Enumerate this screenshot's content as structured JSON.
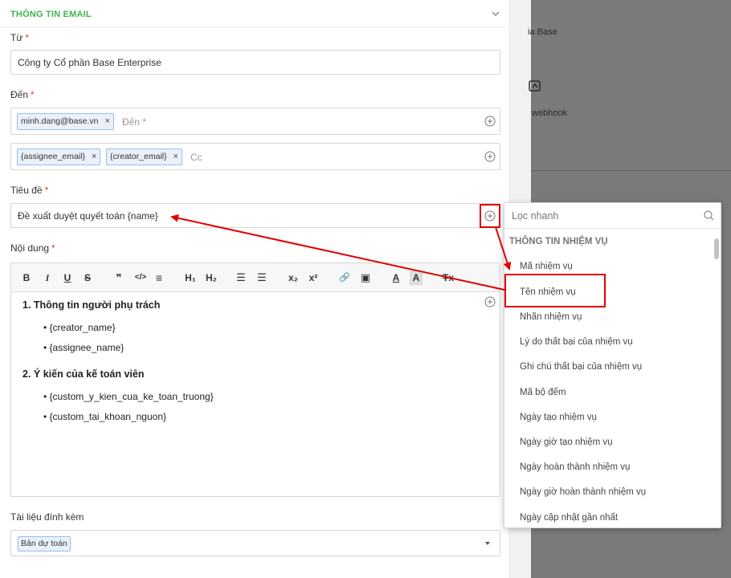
{
  "background": {
    "text_1": "ia Base",
    "text_2": "webhook"
  },
  "section": {
    "title": "THÔNG TIN EMAIL",
    "chevron_icon": "chevron-down-icon"
  },
  "from": {
    "label": "Từ",
    "required": "*",
    "value": "Công ty Cổ phần Base Enterprise"
  },
  "to": {
    "label": "Đến",
    "required": "*",
    "tags": [
      "minh.dang@base.vn"
    ],
    "placeholder": "Đến *"
  },
  "cc": {
    "tags": [
      "{assignee_email}",
      "{creator_email}"
    ],
    "placeholder": "Cc"
  },
  "tag_remove": "×",
  "subject": {
    "label": "Tiêu đề",
    "required": "*",
    "value": "Đề xuất duyệt quyết toán {name}"
  },
  "content": {
    "label": "Nội dung",
    "required": "*",
    "toolbar": {
      "bold": "B",
      "italic": "I",
      "underline": "U",
      "strike": "S",
      "quote": "❞",
      "code": "</>",
      "align": "≡",
      "h1": "H₁",
      "h2": "H₂",
      "ordered_list": "☰",
      "bullet_list": "☰",
      "subscript": "x₂",
      "superscript": "x²",
      "link": "🔗",
      "image": "▣",
      "text_color": "A",
      "bg_color": "A",
      "clear": "Tx"
    },
    "heading_1": "1. Thông tin người phụ trách",
    "items_1": [
      "{creator_name}",
      "{assignee_name}"
    ],
    "heading_2": "2. Ý kiến của kế toán viên",
    "items_2": [
      "{custom_y_kien_cua_ke_toan_truong}",
      "{custom_tai_khoan_nguon}"
    ],
    "bullet": "•"
  },
  "attachments": {
    "label": "Tài liệu đính kèm",
    "value": "Bản dự toán"
  },
  "dropdown": {
    "search_placeholder": "Lọc nhanh",
    "group": "THÔNG TIN NHIỆM VỤ",
    "items": [
      "Mã nhiệm vụ",
      "Tên nhiệm vụ",
      "Nhãn nhiệm vụ",
      "Lý do thất bại của nhiệm vụ",
      "Ghi chú thất bại của nhiệm vụ",
      "Mã bộ đếm",
      "Ngày tạo nhiệm vụ",
      "Ngày giờ tạo nhiệm vụ",
      "Ngày hoàn thành nhiệm vụ",
      "Ngày giờ hoàn thành nhiệm vụ",
      "Ngày cập nhật gần nhất"
    ],
    "highlighted_item": "Tên nhiệm vụ"
  },
  "colors": {
    "accent_green": "#3fb34f",
    "required_red": "#e53935",
    "annotation_red": "#e00000",
    "tag_bg": "#eaf1fb"
  }
}
